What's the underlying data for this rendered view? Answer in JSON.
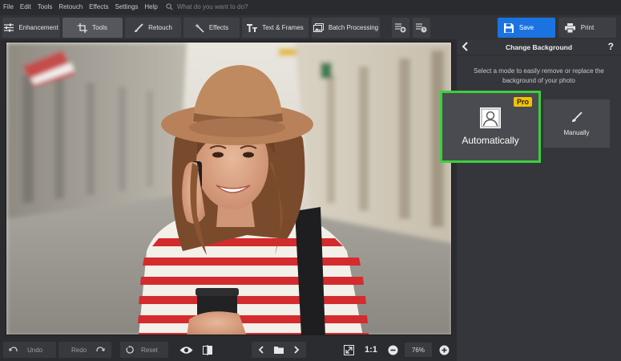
{
  "menu": [
    "File",
    "Edit",
    "Tools",
    "Retouch",
    "Effects",
    "Settings",
    "Help"
  ],
  "search_placeholder": "What do you want to do?",
  "toolbar": {
    "enhancement": "Enhancement",
    "tools": "Tools",
    "retouch": "Retouch",
    "effects": "Effects",
    "text_frames": "Text & Frames",
    "batch": "Batch Processing",
    "save": "Save",
    "print": "Print"
  },
  "panel": {
    "title": "Change Background",
    "help": "?",
    "description": "Select a mode to easily remove or replace the background of your photo",
    "auto_label": "Automatically",
    "pro_badge": "Pro",
    "manual_label": "Manually"
  },
  "bottom": {
    "undo": "Undo",
    "redo": "Redo",
    "reset": "Reset",
    "one_to_one": "1:1",
    "zoom": "76%"
  },
  "colors": {
    "accent_blue": "#1a73e0",
    "highlight_green": "#3ccf3c",
    "pro_yellow": "#f2c200"
  }
}
